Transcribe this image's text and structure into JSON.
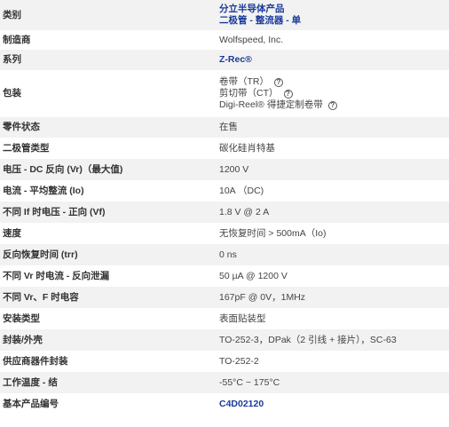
{
  "rows": [
    {
      "label": "类别",
      "value_lines": [
        "分立半导体产品",
        "二极管 - 整流器 - 单"
      ]
    },
    {
      "label": "制造商",
      "value": "Wolfspeed, Inc."
    },
    {
      "label": "系列",
      "value": "Z-Rec®"
    },
    {
      "label": "包装",
      "packaging": [
        {
          "text": "卷带（TR）",
          "icon": "help-icon"
        },
        {
          "text": "剪切带（CT）",
          "icon": "help-icon"
        },
        {
          "text": "Digi-Reel® 得捷定制卷带",
          "icon": "help-icon"
        }
      ]
    },
    {
      "label": "零件状态",
      "value": "在售"
    },
    {
      "label": "二极管类型",
      "value": "碳化硅肖特基"
    },
    {
      "label": "电压 - DC 反向 (Vr)（最大值)",
      "value": "1200 V"
    },
    {
      "label": "电流 - 平均整流 (Io)",
      "value": "10A （DC)"
    },
    {
      "label": "不同 If 时电压 - 正向 (Vf)",
      "value": "1.8 V @ 2 A"
    },
    {
      "label": "速度",
      "value": "无恢复时间 > 500mA（Io)"
    },
    {
      "label": "反向恢复时间 (trr)",
      "value": "0 ns"
    },
    {
      "label": "不同 Vr 时电流 - 反向泄漏",
      "value": "50 µA @ 1200 V"
    },
    {
      "label": "不同 Vr、F 时电容",
      "value": "167pF @ 0V，1MHz"
    },
    {
      "label": "安装类型",
      "value": "表面贴装型"
    },
    {
      "label": "封装/外壳",
      "value": "TO-252-3，DPak（2 引线 + 接片），SC-63"
    },
    {
      "label": "供应商器件封装",
      "value": "TO-252-2"
    },
    {
      "label": "工作温度 - 结",
      "value": "-55°C ~ 175°C"
    },
    {
      "label": "基本产品编号",
      "value": "C4D02120"
    }
  ],
  "colors": {
    "link": "#1a3a9c",
    "row_alt": "#f2f2f2"
  }
}
